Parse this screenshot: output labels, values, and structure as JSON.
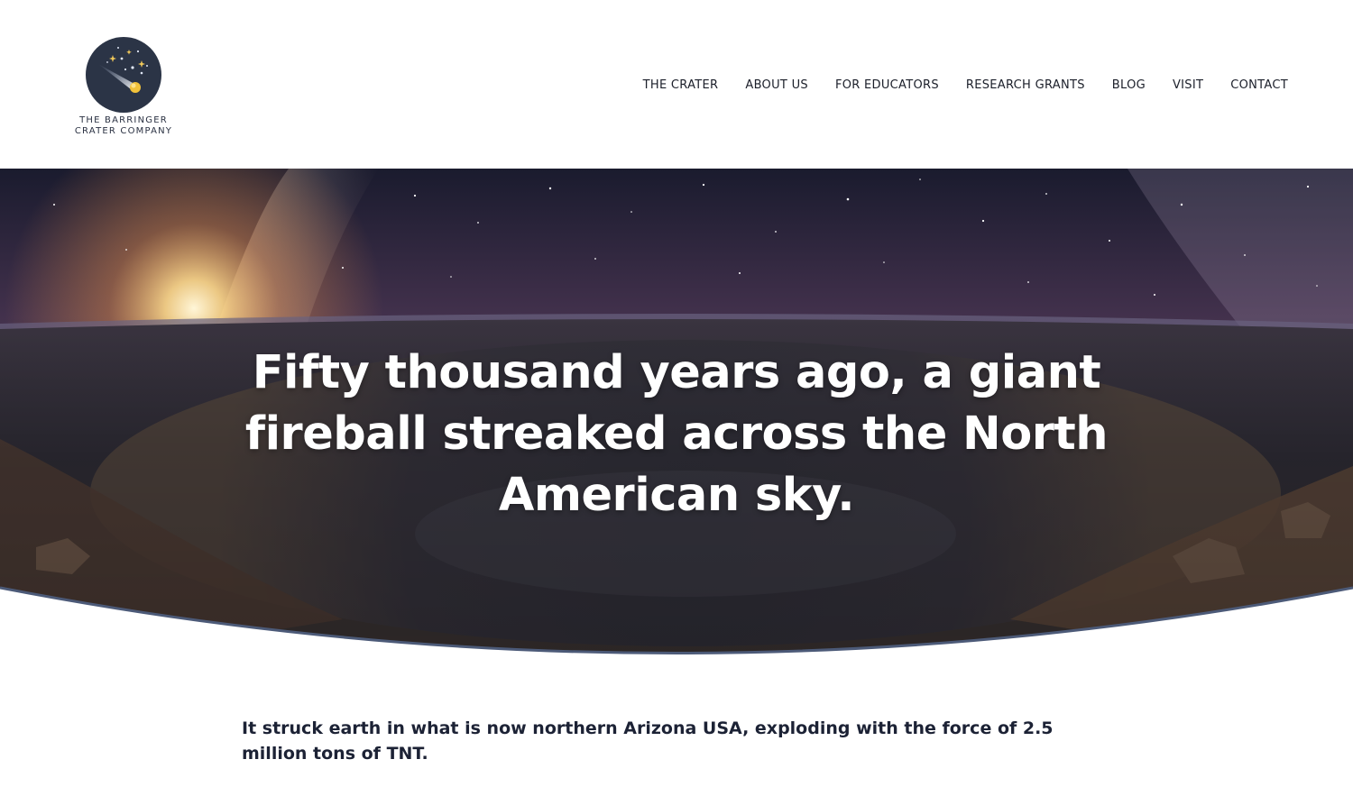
{
  "brand": {
    "name_line1": "THE BARRINGER",
    "name_line2": "CRATER COMPANY"
  },
  "nav": {
    "items": [
      {
        "label": "THE CRATER"
      },
      {
        "label": "ABOUT US"
      },
      {
        "label": "FOR EDUCATORS"
      },
      {
        "label": "RESEARCH GRANTS"
      },
      {
        "label": "BLOG"
      },
      {
        "label": "VISIT"
      },
      {
        "label": "CONTACT"
      }
    ]
  },
  "hero": {
    "title": "Fifty thousand years ago, a giant fireball streaked across the North American sky.",
    "image": "night-sky-over-meteor-crater"
  },
  "intro": {
    "text": "It struck earth in what is now northern Arizona USA, exploding with the force of 2.5 million tons of TNT."
  },
  "colors": {
    "brand_navy": "#2b3446",
    "text_dark": "#1c2235",
    "curve_accent": "#4c5a78"
  }
}
